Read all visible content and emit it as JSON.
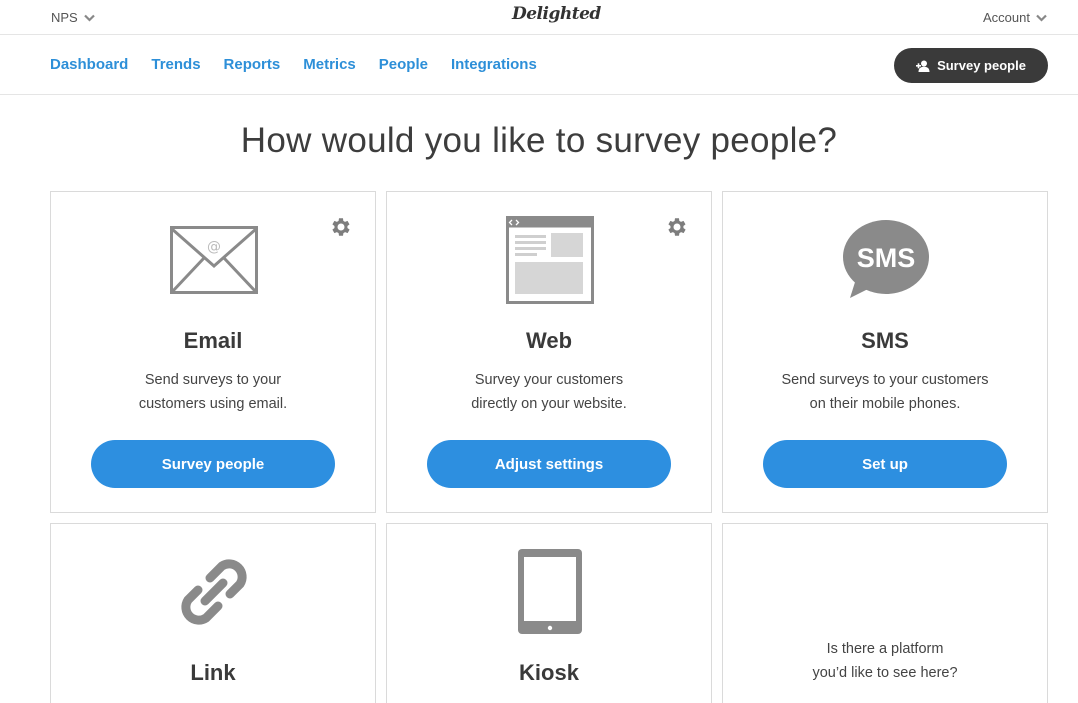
{
  "topbar": {
    "product_label": "NPS",
    "logo_text": "Delighted",
    "account_label": "Account"
  },
  "nav": {
    "items": [
      "Dashboard",
      "Trends",
      "Reports",
      "Metrics",
      "People",
      "Integrations"
    ],
    "survey_button_label": "Survey people"
  },
  "main": {
    "heading": "How would you like to survey people?"
  },
  "cards": {
    "email": {
      "title": "Email",
      "desc_line1": "Send surveys to your",
      "desc_line2": "customers using email.",
      "button": "Survey people",
      "icon": "envelope-icon"
    },
    "web": {
      "title": "Web",
      "desc_line1": "Survey your customers",
      "desc_line2": "directly on your website.",
      "button": "Adjust settings",
      "icon": "browser-window-icon"
    },
    "sms": {
      "title": "SMS",
      "desc_line1": "Send surveys to your customers",
      "desc_line2": "on their mobile phones.",
      "button": "Set up",
      "icon": "sms-bubble-icon",
      "icon_text": "SMS"
    },
    "link": {
      "title": "Link",
      "icon": "chain-link-icon"
    },
    "kiosk": {
      "title": "Kiosk",
      "icon": "tablet-icon"
    },
    "suggest": {
      "line1": "Is there a platform",
      "line2": "you’d like to see here?"
    }
  },
  "colors": {
    "accent": "#2d8fe0",
    "nav_link": "#2d8fd8",
    "dark_button": "#3a3a3a",
    "icon_gray": "#8a8a8a"
  }
}
